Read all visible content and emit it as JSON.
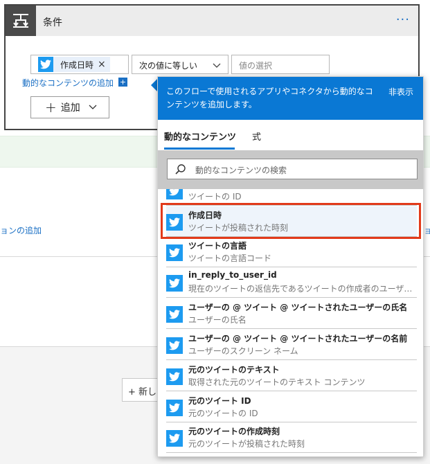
{
  "colors": {
    "accent": "#0a78d4",
    "twitter": "#1d9bf0",
    "link": "#1a6fc4",
    "highlight": "#e23a1a"
  },
  "background": {
    "left_link": "ョンの追加",
    "right_link": "ョ",
    "new_step_label": "+ 新しい"
  },
  "condition": {
    "title": "条件",
    "more_label": "···",
    "token_label": "作成日時",
    "token_remove": "×",
    "operator": "次の値に等しい",
    "value_placeholder": "値の選択",
    "dynamic_link": "動的なコンテンツの追加",
    "dynamic_link_plus": "+",
    "add_button_label": "追加"
  },
  "popup": {
    "description": "このフローで使用されるアプリやコネクタから動的なコンテンツを追加します。",
    "hide_label": "非表示",
    "tabs": [
      "動的なコンテンツ",
      "式"
    ],
    "search_placeholder": "動的なコンテンツの検索",
    "items": [
      {
        "title": "",
        "subtitle": "ツイートの ID"
      },
      {
        "title": "作成日時",
        "subtitle": "ツイートが投稿された時刻",
        "selected": true
      },
      {
        "title": "ツイートの言語",
        "subtitle": "ツイートの言語コード"
      },
      {
        "title": "in_reply_to_user_id",
        "subtitle": "現在のツイートの返信先であるツイートの作成者のユーザー..."
      },
      {
        "title": "ユーザーの @ ツイート @ ツイートされたユーザーの氏名",
        "subtitle": "ユーザーの氏名"
      },
      {
        "title": "ユーザーの @ ツイート @ ツイートされたユーザーの名前",
        "subtitle": "ユーザーのスクリーン ネーム"
      },
      {
        "title": "元のツイートのテキスト",
        "subtitle": "取得された元のツイートのテキスト コンテンツ"
      },
      {
        "title": "元のツイート ID",
        "subtitle": "元のツイートの ID"
      },
      {
        "title": "元のツイートの作成時刻",
        "subtitle": "元のツイートが投稿された時刻"
      }
    ]
  }
}
